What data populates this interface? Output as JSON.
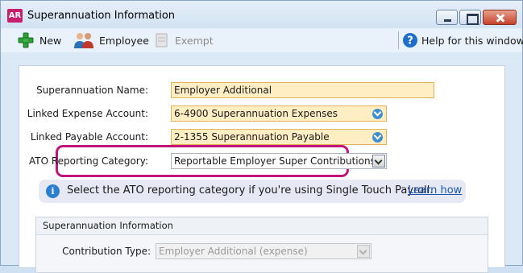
{
  "window": {
    "logo_text": "AR",
    "title": "Superannuation Information"
  },
  "toolbar": {
    "new_label": "New",
    "employee_label": "Employee",
    "exempt_label": "Exempt",
    "help_label": "Help for this window"
  },
  "form": {
    "name_label": "Superannuation Name:",
    "name_value": "Employer Additional",
    "expense_label": "Linked Expense Account:",
    "expense_value": "6-4900 Superannuation Expenses",
    "payable_label": "Linked Payable Account:",
    "payable_value": "2-1355 Superannuation Payable",
    "ato_label": "ATO Reporting Category:",
    "ato_value": "Reportable Employer Super Contributions"
  },
  "info": {
    "icon_glyph": "i",
    "text": "Select the ATO reporting category if you're using Single Touch Payroll.",
    "link": "Learn how"
  },
  "group": {
    "title": "Superannuation Information",
    "contribution_label": "Contribution Type:",
    "contribution_value": "Employer Additional (expense)"
  },
  "colors": {
    "highlight": "#c0157a",
    "field_bg": "#ffedc4",
    "link": "#1a55b0"
  }
}
